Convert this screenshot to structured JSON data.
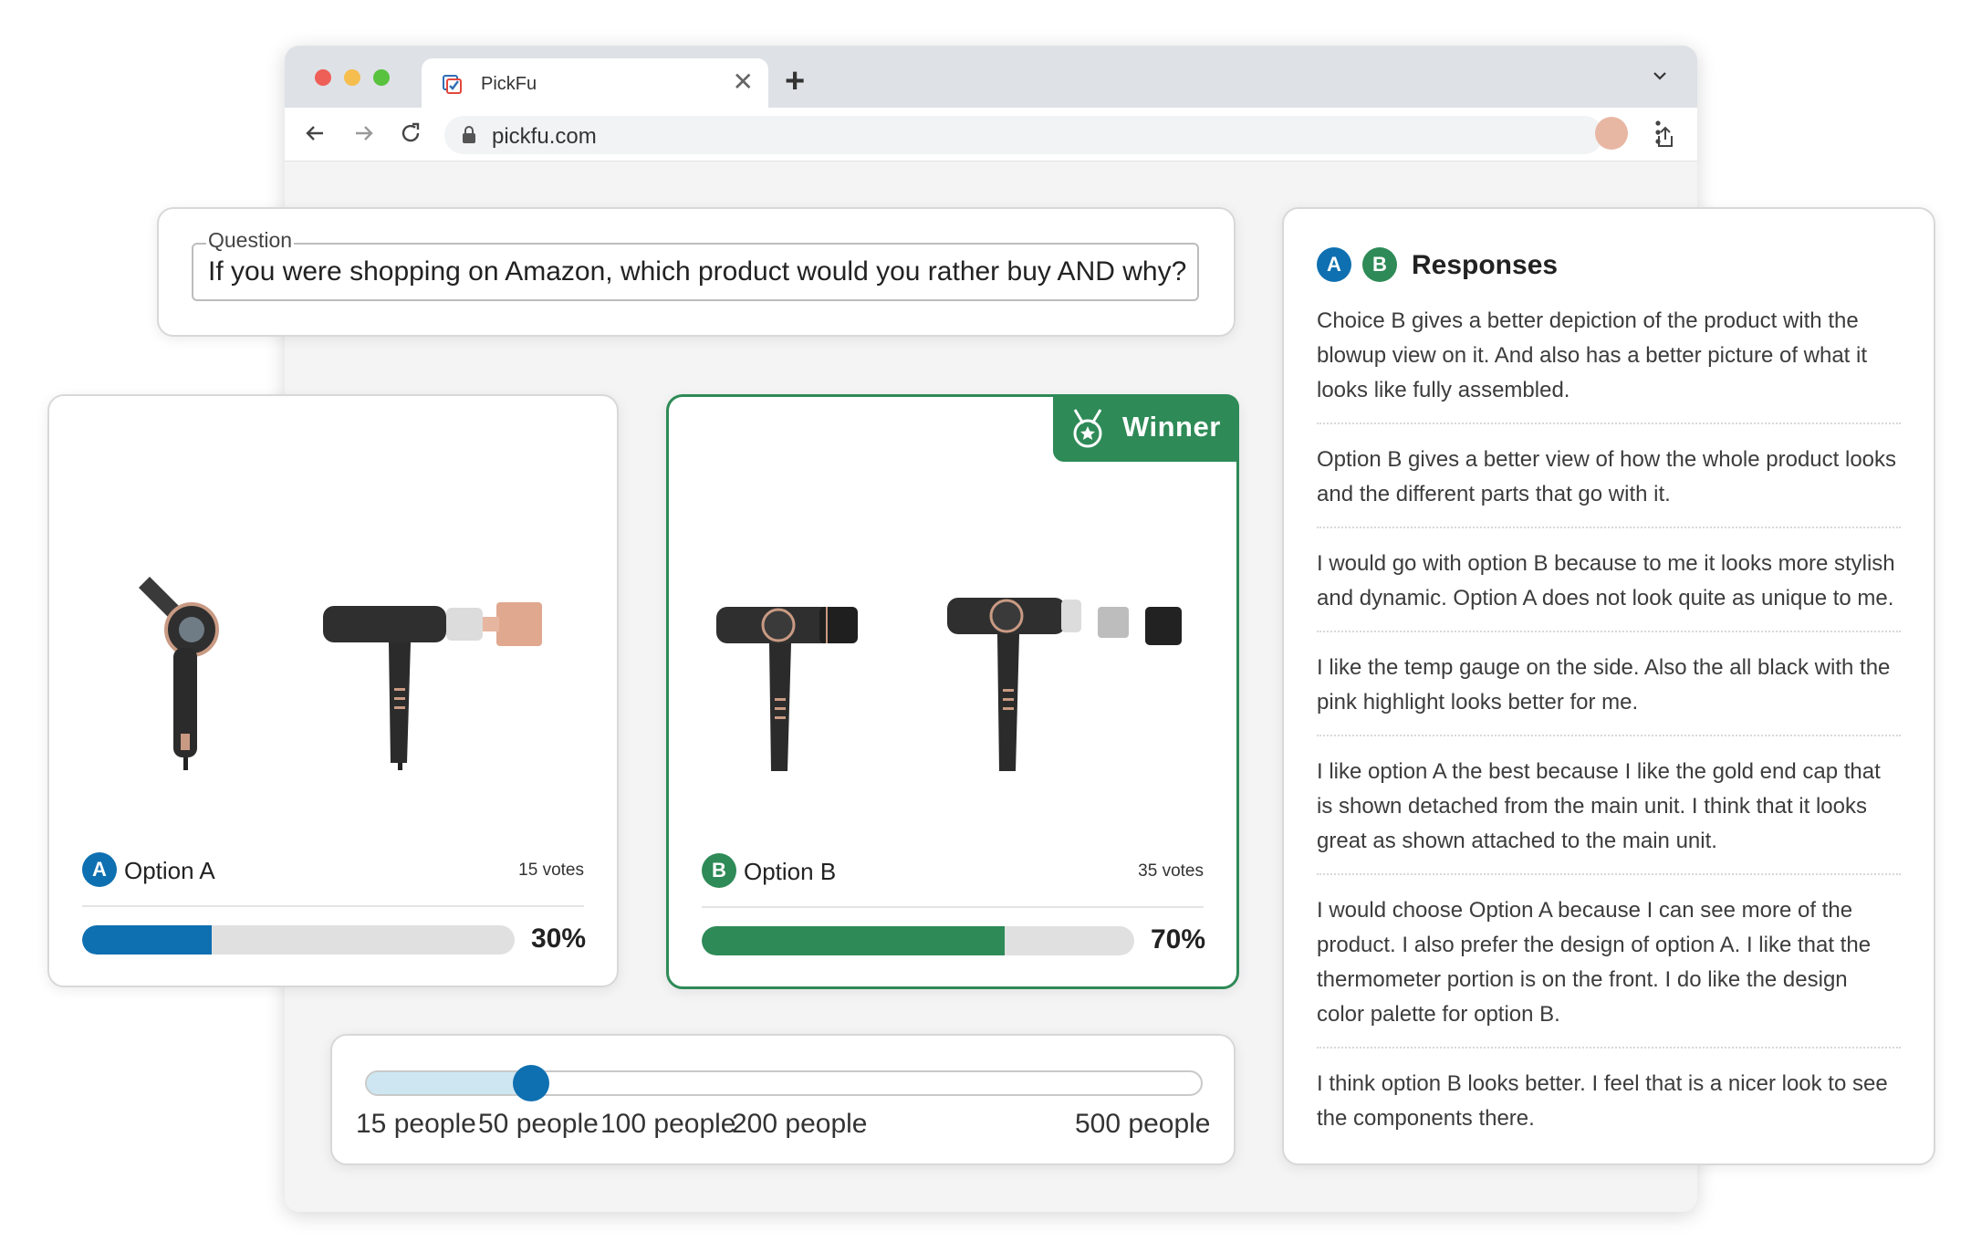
{
  "browser": {
    "tab_title": "PickFu",
    "url": "pickfu.com"
  },
  "question": {
    "legend": "Question",
    "text": "If you were shopping on Amazon, which product would you rather buy AND why?"
  },
  "options": [
    {
      "badge": "A",
      "label": "Option A",
      "votes": "15 votes",
      "percent_label": "30%",
      "percent": 30
    },
    {
      "badge": "B",
      "label": "Option B",
      "votes": "35 votes",
      "percent_label": "70%",
      "percent": 70
    }
  ],
  "winner_label": "Winner",
  "audience_slider": {
    "labels": [
      "15 people",
      "50 people",
      "100 people",
      "200 people",
      "500 people"
    ],
    "selected_index": 1
  },
  "responses": {
    "badges": [
      "A",
      "B"
    ],
    "title": "Responses",
    "items": [
      "Choice B gives a better depiction of the product with the blowup view on it. And also has a better picture of what it looks like fully assembled.",
      "Option B gives a better view of how the whole product looks and the different parts that go with it.",
      "I would go with option B because to me it looks more stylish and dynamic. Option A does not look quite as unique to me.",
      "I like the temp gauge on the side. Also the all black with the pink highlight looks better for me.",
      "I like option A the best because I like the gold end cap that is shown detached from the main unit. I think that it looks great as shown attached to the main unit.",
      "I would choose Option A because I can see more of the product. I also prefer the design of option A. I like that the thermometer portion is on the front. I do like the design color palette for option B.",
      "I think option B looks better. I feel that is a nicer look to see the components there."
    ]
  },
  "colors": {
    "option_a": "#0e70b1",
    "option_b": "#2e8a57",
    "slider_fill": "#cde6f2"
  }
}
